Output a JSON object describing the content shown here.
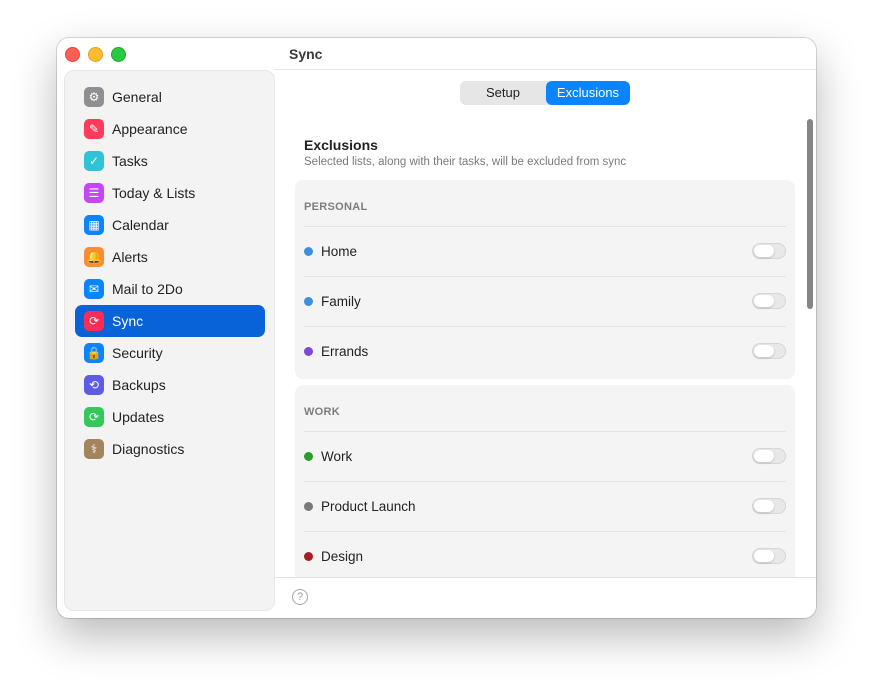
{
  "window": {
    "title": "Sync"
  },
  "sidebar": {
    "items": [
      {
        "label": "General",
        "icon": "gear-icon",
        "color": "#8e8e93",
        "glyph": "⚙"
      },
      {
        "label": "Appearance",
        "icon": "brush-icon",
        "color": "#ff3b5c",
        "glyph": "✎"
      },
      {
        "label": "Tasks",
        "icon": "checkmark-icon",
        "color": "#2ec4d6",
        "glyph": "✓"
      },
      {
        "label": "Today & Lists",
        "icon": "list-icon",
        "color": "#c644fc",
        "glyph": "☰"
      },
      {
        "label": "Calendar",
        "icon": "calendar-icon",
        "color": "#0a84ff",
        "glyph": "▦"
      },
      {
        "label": "Alerts",
        "icon": "bell-icon",
        "color": "#ff8c2e",
        "glyph": "🔔"
      },
      {
        "label": "Mail to 2Do",
        "icon": "envelope-icon",
        "color": "#0a84ff",
        "glyph": "✉"
      },
      {
        "label": "Sync",
        "icon": "sync-icon",
        "color": "#ff2d55",
        "glyph": "⟳",
        "selected": true
      },
      {
        "label": "Security",
        "icon": "lock-icon",
        "color": "#0a84ff",
        "glyph": "🔒"
      },
      {
        "label": "Backups",
        "icon": "clock-icon",
        "color": "#5e5ce6",
        "glyph": "⟲"
      },
      {
        "label": "Updates",
        "icon": "refresh-icon",
        "color": "#34c759",
        "glyph": "⟳"
      },
      {
        "label": "Diagnostics",
        "icon": "stethoscope-icon",
        "color": "#a2845e",
        "glyph": "⚕"
      }
    ]
  },
  "tabs": {
    "setup": "Setup",
    "exclusions": "Exclusions",
    "selected": "Exclusions"
  },
  "main": {
    "heading": "Exclusions",
    "subheading": "Selected lists, along with their tasks, will be excluded from sync",
    "groups": [
      {
        "title": "PERSONAL",
        "rows": [
          {
            "label": "Home",
            "color": "#3b8fe0",
            "enabled": false
          },
          {
            "label": "Family",
            "color": "#3b8fe0",
            "enabled": false
          },
          {
            "label": "Errands",
            "color": "#7b4ad6",
            "enabled": false
          }
        ]
      },
      {
        "title": "WORK",
        "rows": [
          {
            "label": "Work",
            "color": "#2e9b2e",
            "enabled": false
          },
          {
            "label": "Product Launch",
            "color": "#7a7a7a",
            "enabled": false
          },
          {
            "label": "Design",
            "color": "#a31f24",
            "enabled": false
          }
        ]
      }
    ]
  },
  "footer": {
    "help_glyph": "?"
  }
}
